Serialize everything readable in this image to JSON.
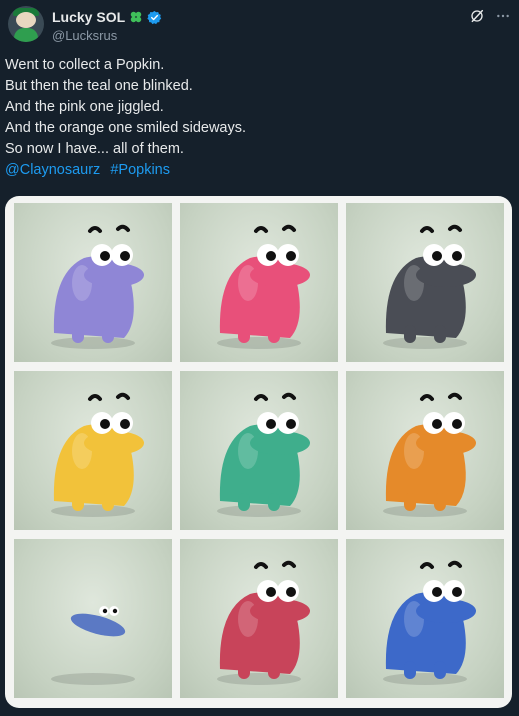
{
  "author": {
    "display_name": "Lucky SOL",
    "handle": "@Lucksrus",
    "icons": [
      "clover-icon",
      "verified-badge-icon"
    ]
  },
  "header_actions": [
    "grok-icon",
    "more-icon"
  ],
  "tweet": {
    "lines": [
      "Went to collect a Popkin.",
      "But then the teal one blinked.",
      "And the pink one jiggled.",
      "And the orange one smiled sideways.",
      "So now I have... all of them."
    ],
    "mention": "@Claynosaurz",
    "hashtag": "#Popkins"
  },
  "media": {
    "images": [
      {
        "character": "purple creature",
        "color": "#8f86d6"
      },
      {
        "character": "pink creature",
        "color": "#e8507a"
      },
      {
        "character": "gray creature",
        "color": "#4a4d55"
      },
      {
        "character": "yellow creature",
        "color": "#f2c23a"
      },
      {
        "character": "teal creature",
        "color": "#3fae8c"
      },
      {
        "character": "orange creature",
        "color": "#e58a2a"
      },
      {
        "character": "small blue creature",
        "color": "#5b79c4"
      },
      {
        "character": "red creature",
        "color": "#c8445a"
      },
      {
        "character": "blue bird creature",
        "color": "#3d69c9"
      }
    ]
  },
  "colors": {
    "background": "#15202b",
    "text": "#e7e9ea",
    "secondary_text": "#8b98a5",
    "link": "#1d9bf0",
    "verified": "#1d9bf0",
    "clover": "#3fbf5a"
  }
}
